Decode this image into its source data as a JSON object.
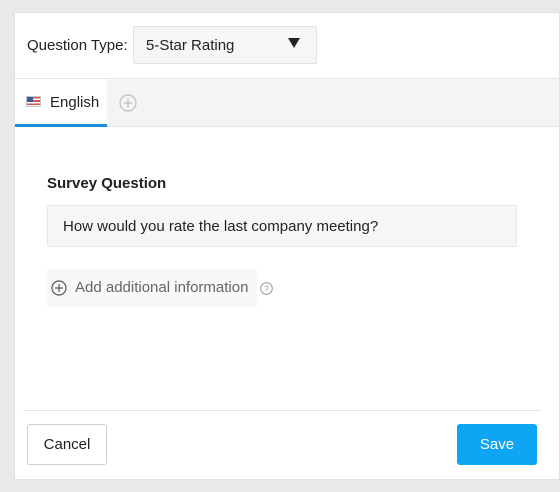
{
  "question_type": {
    "label": "Question Type:",
    "selected": "5-Star Rating"
  },
  "tabs": {
    "items": [
      {
        "label": "English",
        "active": true,
        "icon": "us-flag-icon"
      }
    ],
    "add_icon": "plus-circle-icon"
  },
  "survey_question": {
    "label": "Survey Question",
    "value": "How would you rate the last company meeting?"
  },
  "additional_info": {
    "label": "Add additional information",
    "icon": "plus-circle-icon",
    "help_icon": "question-circle-icon"
  },
  "footer": {
    "cancel_label": "Cancel",
    "save_label": "Save"
  },
  "colors": {
    "accent": "#0ea5f5",
    "tab_underline": "#1a8fd8"
  }
}
